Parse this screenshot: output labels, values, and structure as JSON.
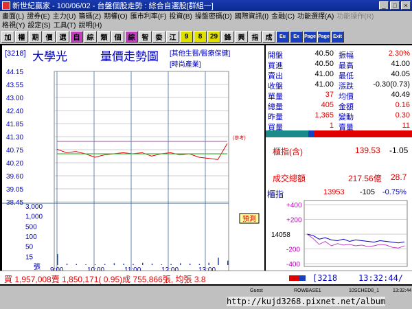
{
  "window": {
    "title": "新世紀贏家 - 100/06/02 - 台盤個股走勢 : 綜合自選股[群組一]",
    "controls": [
      "_",
      "□",
      "×"
    ]
  },
  "menu": {
    "row1": [
      "畫面(L)",
      "證券(E)",
      "主力(U)",
      "籌碼(Z)",
      "期權(O)",
      "匯市利率(F)",
      "投資(B)",
      "操盤密碼(D)",
      "國際資訊(I)",
      "金融(C)",
      "功能選擇(A)"
    ],
    "row1_disabled": [
      "功能操作(R)"
    ],
    "row2": [
      "格視(Y)",
      "設定(S)",
      "工具(T)",
      "說明(H)"
    ]
  },
  "toolbar": {
    "buttons": [
      "加",
      "權",
      "期",
      "價",
      "選",
      "自",
      "綜",
      "類",
      "個",
      "綜",
      "智",
      "委",
      "江",
      "9",
      "8",
      "29",
      "鋒",
      "興",
      "指",
      "成"
    ],
    "blue_buttons": [
      "Eu",
      "Ex",
      "Page",
      "Page",
      "Exit"
    ]
  },
  "stock": {
    "code": "[3218]",
    "name": "大學光",
    "chart_title": "量價走勢圖",
    "industry1": "[其他生醫/醫療保健]",
    "industry2": "[時尚產業]",
    "ref_tag": "(參考)",
    "alert": "預測"
  },
  "chart_data": {
    "type": "line",
    "price_ticks": [
      "44.15",
      "43.55",
      "43.00",
      "42.40",
      "41.85",
      "41.30",
      "40.75",
      "40.20",
      "39.60",
      "39.05",
      "38.45"
    ],
    "volume_ticks": [
      "3,000",
      "1,000",
      "500",
      "100",
      "50",
      "15",
      "張"
    ],
    "time_ticks": [
      "9:00",
      "10:00",
      "11:00",
      "12:00",
      "13:00"
    ],
    "ref_price": 41.3,
    "y_range": [
      38.45,
      44.15
    ],
    "series": [
      {
        "name": "",
        "color": "#e00000",
        "x": [
          "9:00",
          "9:15",
          "9:30",
          "9:45",
          "10:00",
          "10:15",
          "10:30",
          "10:45",
          "11:00",
          "11:15",
          "11:30",
          "11:45",
          "12:00",
          "12:15",
          "12:30",
          "12:45",
          "13:00",
          "13:15",
          "13:30"
        ],
        "values": [
          40.75,
          40.6,
          40.65,
          40.55,
          40.4,
          40.5,
          40.55,
          40.6,
          40.55,
          40.6,
          40.45,
          40.55,
          40.6,
          40.5,
          40.55,
          40.4,
          40.35,
          40.3,
          41.0
        ]
      },
      {
        "name": "",
        "color": "#c040c0",
        "x": [
          "9:00",
          "13:30"
        ],
        "values": [
          41.1,
          41.1
        ]
      },
      {
        "name": "",
        "color": "#40c040",
        "x": [
          "9:00",
          "13:30"
        ],
        "values": [
          40.55,
          40.55
        ]
      }
    ],
    "volumes": [
      30,
      4,
      3,
      2,
      2,
      3,
      5,
      4,
      3,
      6,
      4,
      2,
      3,
      5,
      4,
      3,
      6,
      20,
      12
    ]
  },
  "quote": {
    "rows": [
      {
        "l1": "開盤",
        "v1": "40.50",
        "l2": "振幅",
        "v2": "2.30%",
        "v2red": true
      },
      {
        "l1": "買進",
        "v1": "40.50",
        "l2": "最高",
        "v2": "41.00",
        "v2red": false
      },
      {
        "l1": "賣出",
        "v1": "41.00",
        "l2": "最低",
        "v2": "40.05",
        "v2red": false
      },
      {
        "l1": "收盤",
        "v1": "41.00",
        "l2": "漲跌",
        "v2": "-0.30(0.73)",
        "v2red": false
      },
      {
        "l1": "單量",
        "v1": "37",
        "l2": "均價",
        "v2": "40.49",
        "v2red": false
      },
      {
        "l1": "總量",
        "v1": "405",
        "l2": "金額",
        "v2": "0.16",
        "v2red": true
      },
      {
        "l1": "昨量",
        "v1": "1,365",
        "l2": "變動",
        "v2": "0.30",
        "v2red": true
      },
      {
        "l1": "買量",
        "v1": "1",
        "l2": "賣量",
        "v2": "11",
        "v2red": true
      }
    ]
  },
  "index_info": {
    "label": "櫃指(含)",
    "value": "139.53",
    "change": "-1.05",
    "turnover_label": "成交總額",
    "turnover_value": "217.56億",
    "turnover_change": "28.7"
  },
  "mini_chart": {
    "label": "櫃指",
    "value": "13953",
    "change": "-105",
    "pct": "-0.75%",
    "ticks": [
      "+400",
      "+200",
      "14058",
      "-200",
      "-400"
    ],
    "series": [
      {
        "color": "#0000c0",
        "values": [
          14058,
          14040,
          13990,
          14010,
          13980,
          13970,
          13990,
          13960,
          13980,
          13970,
          13960,
          13950,
          13970,
          13960,
          13950,
          13940,
          13953
        ]
      },
      {
        "color": "#c040c0",
        "values": [
          14058,
          14000,
          13920,
          13960,
          13900,
          13930,
          13910,
          13920,
          13900,
          13910,
          13890,
          13900,
          13920,
          13910,
          13880,
          13870,
          13900
        ]
      }
    ]
  },
  "ticker": {
    "text": "買 1,957,008賣 1,850,171( 0.95)成 755,866張, 均張 3.8",
    "code": "[3218",
    "time": "13:32:44/"
  },
  "statusbar": {
    "items": [
      "Guest",
      "ROWBASE1",
      "10SCHED8_1",
      "13:32:44"
    ]
  },
  "watermark": "http://kujd3268.pixnet.net/album"
}
